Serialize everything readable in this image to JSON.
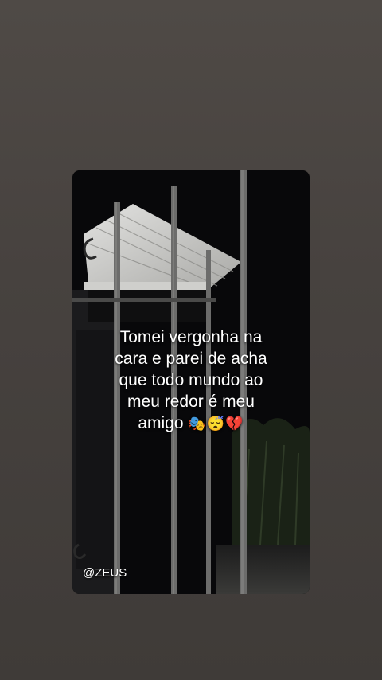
{
  "story": {
    "caption_lines": [
      "Tomei vergonha na",
      "cara e parei de acha",
      "que todo mundo ao",
      "meu redor é meu",
      "amigo"
    ],
    "caption_emojis": "🎭😴💔",
    "watermark": "@ZEUS"
  },
  "colors": {
    "page_background": "#46413d",
    "card_background": "#0a0a0b",
    "text": "#ffffff"
  }
}
